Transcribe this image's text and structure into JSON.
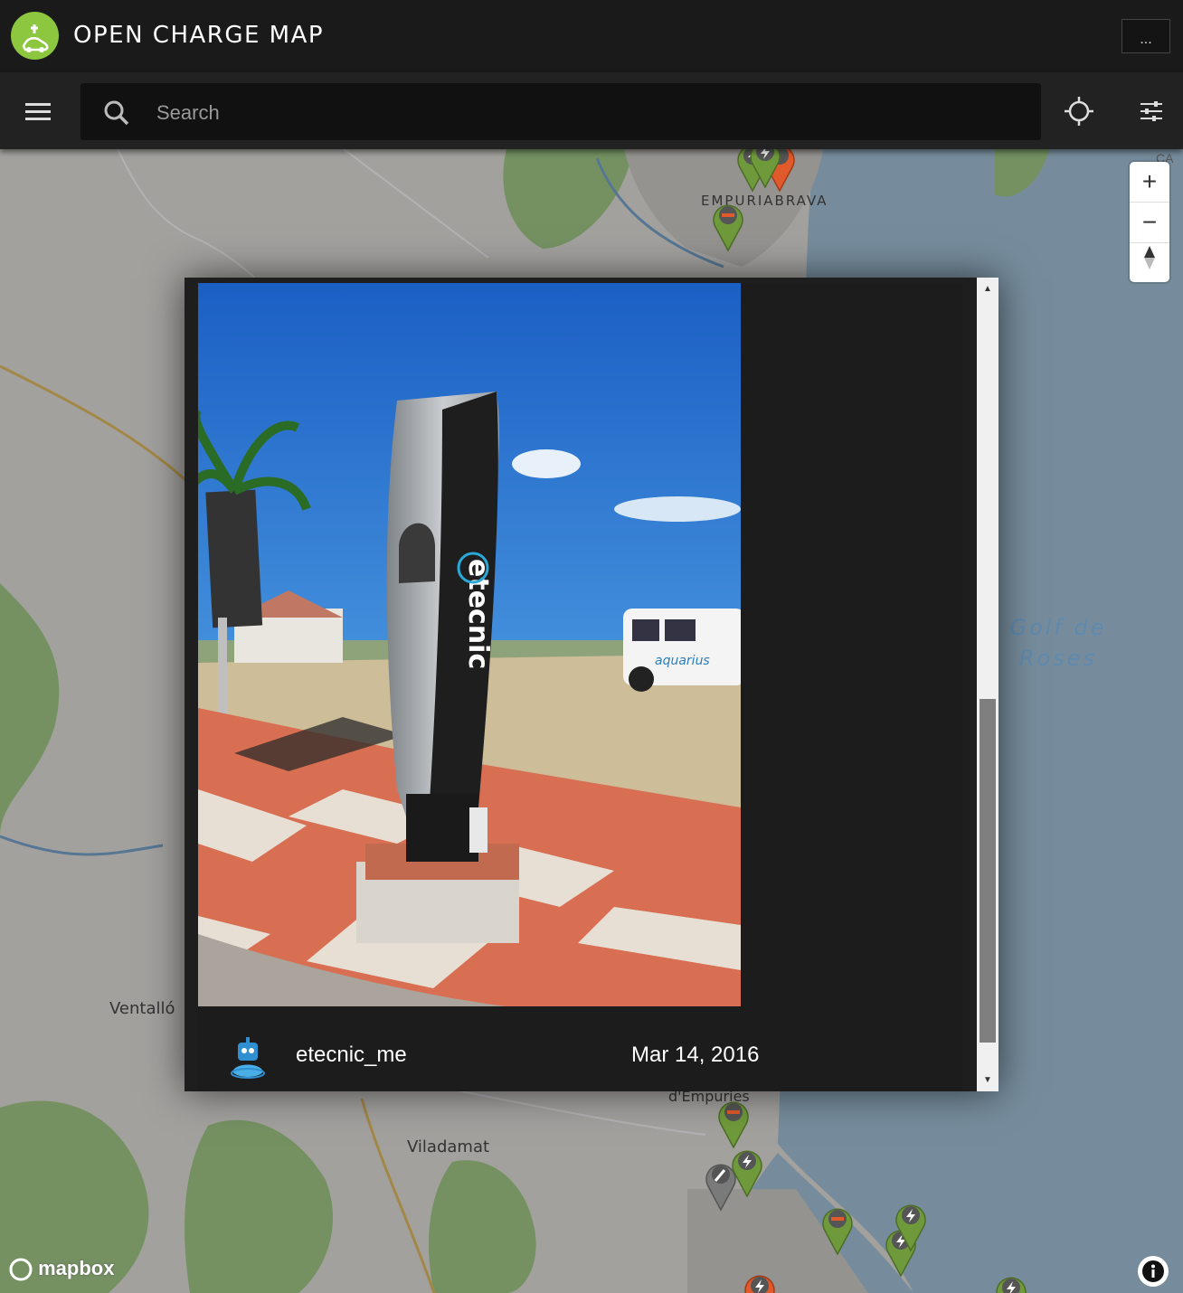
{
  "app": {
    "title": "OPEN CHARGE MAP",
    "more_label": "..."
  },
  "toolbar": {
    "search_placeholder": "Search"
  },
  "map": {
    "places": [
      "EMPURIABRAVA",
      "Ventalló",
      "Viladamat",
      "d'Empuries"
    ],
    "sea_label_line1": "Golf de",
    "sea_label_line2": "Roses",
    "corner_label": "CA\nP",
    "attribution": "mapbox",
    "zoom_in": "+",
    "zoom_out": "−",
    "colors": {
      "operational": "#6f9a3b",
      "non_operational": "#e05a2b",
      "unknown": "#7a7a7a",
      "water": "#a9c9e0",
      "land_green": "#a8d08d"
    }
  },
  "photo_modal": {
    "uploader": "etecnic_me",
    "date": "Mar 14, 2016",
    "photo_brand": "etecnic",
    "van_text": "aquarius"
  }
}
